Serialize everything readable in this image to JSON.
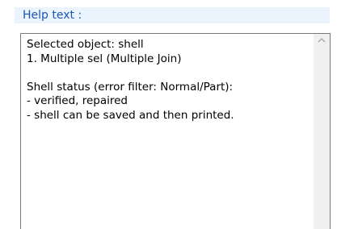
{
  "help_panel": {
    "title": "Help text :",
    "lines": [
      "Selected object: shell",
      "1. Multiple sel (Multiple Join)",
      "",
      "Shell status (error filter: Normal/Part):",
      "- verified, repaired",
      "- shell can be saved and then printed."
    ]
  },
  "scrollbar": {
    "up_icon": "chevron-up-icon"
  },
  "colors": {
    "header_bg": "#ebf4fc",
    "header_text": "#1c55b8",
    "frame_border": "#7a7a7a",
    "scrollbar_track": "#f0f0f0",
    "scroll_arrow": "#a6a6a6"
  }
}
